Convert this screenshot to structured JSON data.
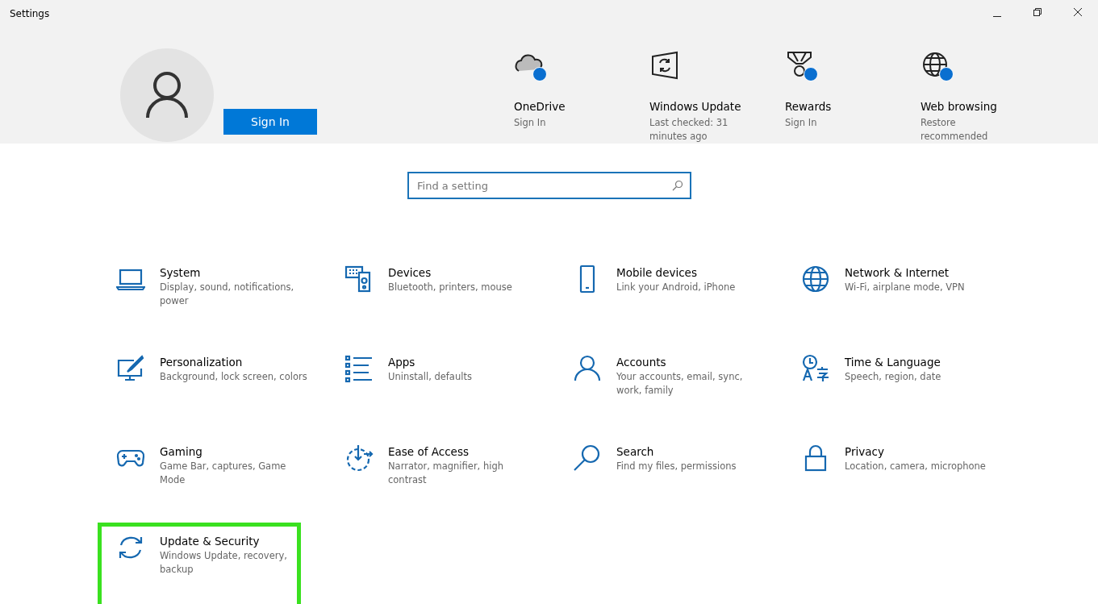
{
  "window": {
    "title": "Settings",
    "controls": [
      {
        "kind": "minimize"
      },
      {
        "kind": "restore"
      },
      {
        "kind": "close"
      }
    ]
  },
  "account": {
    "button": "Sign In"
  },
  "header_items": [
    {
      "kind": "cloud",
      "title": "OneDrive",
      "subtitle": "Sign In",
      "badge": true
    },
    {
      "kind": "update",
      "title": "Windows Update",
      "subtitle": "Last checked: 31 minutes ago",
      "badge": false
    },
    {
      "kind": "medal",
      "title": "Rewards",
      "subtitle": "Sign In",
      "badge": true
    },
    {
      "kind": "globe",
      "title": "Web browsing",
      "subtitle": "Restore recommended",
      "badge": true
    }
  ],
  "search": {
    "placeholder": "Find a setting"
  },
  "categories": [
    {
      "kind": "laptop",
      "title": "System",
      "subtitle": "Display, sound, notifications, power",
      "highlighted": false
    },
    {
      "kind": "devices",
      "title": "Devices",
      "subtitle": "Bluetooth, printers, mouse",
      "highlighted": false
    },
    {
      "kind": "phone",
      "title": "Mobile devices",
      "subtitle": "Link your Android, iPhone",
      "highlighted": false
    },
    {
      "kind": "globe",
      "title": "Network & Internet",
      "subtitle": "Wi-Fi, airplane mode, VPN",
      "highlighted": false
    },
    {
      "kind": "paint",
      "title": "Personalization",
      "subtitle": "Background, lock screen, colors",
      "highlighted": false
    },
    {
      "kind": "list",
      "title": "Apps",
      "subtitle": "Uninstall, defaults",
      "highlighted": false
    },
    {
      "kind": "person",
      "title": "Accounts",
      "subtitle": "Your accounts, email, sync, work, family",
      "highlighted": false
    },
    {
      "kind": "language",
      "title": "Time & Language",
      "subtitle": "Speech, region, date",
      "highlighted": false
    },
    {
      "kind": "gamepad",
      "title": "Gaming",
      "subtitle": "Game Bar, captures, Game Mode",
      "highlighted": false
    },
    {
      "kind": "access",
      "title": "Ease of Access",
      "subtitle": "Narrator, magnifier, high contrast",
      "highlighted": false
    },
    {
      "kind": "search",
      "title": "Search",
      "subtitle": "Find my files, permissions",
      "highlighted": false
    },
    {
      "kind": "lock",
      "title": "Privacy",
      "subtitle": "Location, camera, microphone",
      "highlighted": false
    },
    {
      "kind": "sync",
      "title": "Update & Security",
      "subtitle": "Windows Update, recovery, backup",
      "highlighted": true
    }
  ]
}
